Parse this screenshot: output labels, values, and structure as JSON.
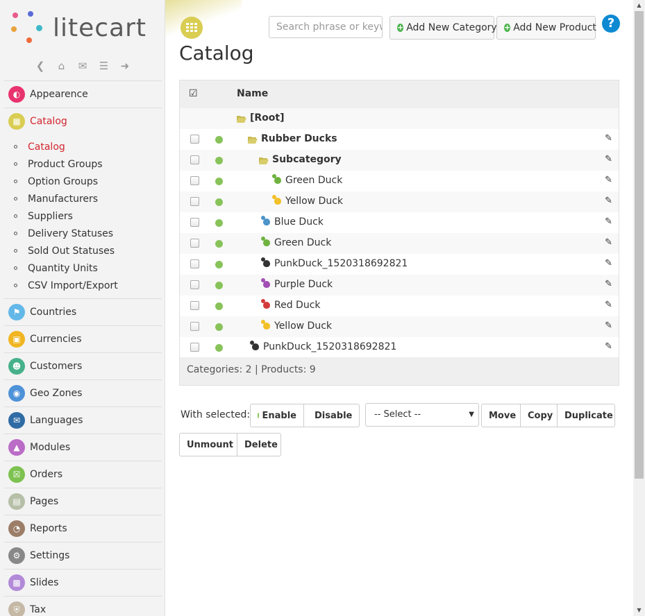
{
  "brand": {
    "name": "litecart"
  },
  "shortcuts": [
    "back-icon",
    "home-icon",
    "mail-icon",
    "database-icon",
    "logout-icon"
  ],
  "sidebar": {
    "items": [
      {
        "label": "Appearence",
        "icon": "appearance-icon",
        "color": "#e8336f"
      },
      {
        "label": "Catalog",
        "icon": "catalog-icon",
        "color": "#d9cd52",
        "active": true
      },
      {
        "label": "Countries",
        "icon": "flag-icon",
        "color": "#63b8e8"
      },
      {
        "label": "Currencies",
        "icon": "money-icon",
        "color": "#f0b521"
      },
      {
        "label": "Customers",
        "icon": "user-icon",
        "color": "#46b18a"
      },
      {
        "label": "Geo Zones",
        "icon": "globe-icon",
        "color": "#4e92d8"
      },
      {
        "label": "Languages",
        "icon": "chat-icon",
        "color": "#2f6ca5"
      },
      {
        "label": "Modules",
        "icon": "cube-icon",
        "color": "#ba6cc6"
      },
      {
        "label": "Orders",
        "icon": "cart-icon",
        "color": "#7dc250"
      },
      {
        "label": "Pages",
        "icon": "file-icon",
        "color": "#b6bfa7"
      },
      {
        "label": "Reports",
        "icon": "piechart-icon",
        "color": "#9c7e68"
      },
      {
        "label": "Settings",
        "icon": "cogs-icon",
        "color": "#888888"
      },
      {
        "label": "Slides",
        "icon": "image-icon",
        "color": "#b28ad8"
      },
      {
        "label": "Tax",
        "icon": "bank-icon",
        "color": "#c5b8a5"
      }
    ],
    "catalog_sub": [
      {
        "label": "Catalog",
        "active": true
      },
      {
        "label": "Product Groups"
      },
      {
        "label": "Option Groups"
      },
      {
        "label": "Manufacturers"
      },
      {
        "label": "Suppliers"
      },
      {
        "label": "Delivery Statuses"
      },
      {
        "label": "Sold Out Statuses"
      },
      {
        "label": "Quantity Units"
      },
      {
        "label": "CSV Import/Export"
      }
    ]
  },
  "header": {
    "title": "Catalog",
    "search_placeholder": "Search phrase or keyword",
    "add_category": "Add New Category",
    "add_product": "Add New Product",
    "help": "?"
  },
  "table": {
    "col_name": "Name",
    "rows": [
      {
        "kind": "root",
        "label": "[Root]"
      },
      {
        "kind": "folder",
        "label": "Rubber Ducks",
        "bold": true
      },
      {
        "kind": "folder",
        "label": "Subcategory",
        "bold": true
      },
      {
        "kind": "product",
        "label": "Green Duck",
        "color": "#6fb23f"
      },
      {
        "kind": "product",
        "label": "Yellow Duck",
        "color": "#f2c028"
      },
      {
        "kind": "product",
        "label": "Blue Duck",
        "color": "#4d94c8"
      },
      {
        "kind": "product",
        "label": "Green Duck",
        "color": "#6fb23f"
      },
      {
        "kind": "product",
        "label": "PunkDuck_1520318692821",
        "color": "#333333"
      },
      {
        "kind": "product",
        "label": "Purple Duck",
        "color": "#a14fb3"
      },
      {
        "kind": "product",
        "label": "Red Duck",
        "color": "#d33b3b"
      },
      {
        "kind": "product",
        "label": "Yellow Duck",
        "color": "#f2c028"
      },
      {
        "kind": "product",
        "label": "PunkDuck_1520318692821",
        "color": "#333333"
      }
    ],
    "footer": "Categories: 2 | Products: 9"
  },
  "bulk": {
    "label": "With selected:",
    "enable": "Enable",
    "disable": "Disable",
    "select_value": "-- Select --",
    "move": "Move",
    "copy": "Copy",
    "duplicate": "Duplicate",
    "unmount": "Unmount",
    "delete": "Delete"
  },
  "colors": {
    "accent_red": "#d3262f",
    "enabled_green": "#88c35a",
    "disabled_red": "#f05a5a",
    "help_blue": "#0d8ad2"
  }
}
